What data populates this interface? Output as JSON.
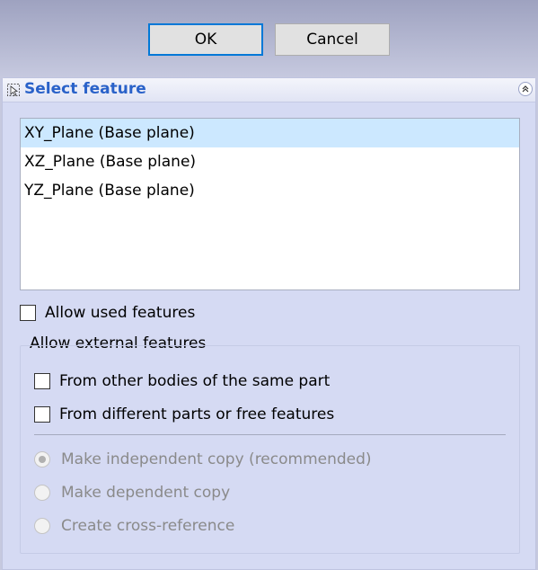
{
  "dialog_buttons": {
    "ok_label": "OK",
    "cancel_label": "Cancel"
  },
  "panel": {
    "title": "Select feature",
    "title_color": "#2a62c9",
    "icons": {
      "header": "select-feature-icon",
      "collapse": "collapse-chevron-icon"
    }
  },
  "feature_list": {
    "items": [
      {
        "label": "XY_Plane (Base plane)",
        "selected": true
      },
      {
        "label": "XZ_Plane (Base plane)",
        "selected": false
      },
      {
        "label": "YZ_Plane (Base plane)",
        "selected": false
      }
    ]
  },
  "allow_used": {
    "label": "Allow used features",
    "checked": false
  },
  "external": {
    "group_label": "Allow external features",
    "other_bodies": {
      "label": "From other bodies of the same part",
      "checked": false
    },
    "different_parts": {
      "label": "From different parts or free features",
      "checked": false
    },
    "radios": [
      {
        "label": "Make independent copy (recommended)",
        "checked": true,
        "enabled": false
      },
      {
        "label": "Make dependent copy",
        "checked": false,
        "enabled": false
      },
      {
        "label": "Create cross-reference",
        "checked": false,
        "enabled": false
      }
    ]
  }
}
